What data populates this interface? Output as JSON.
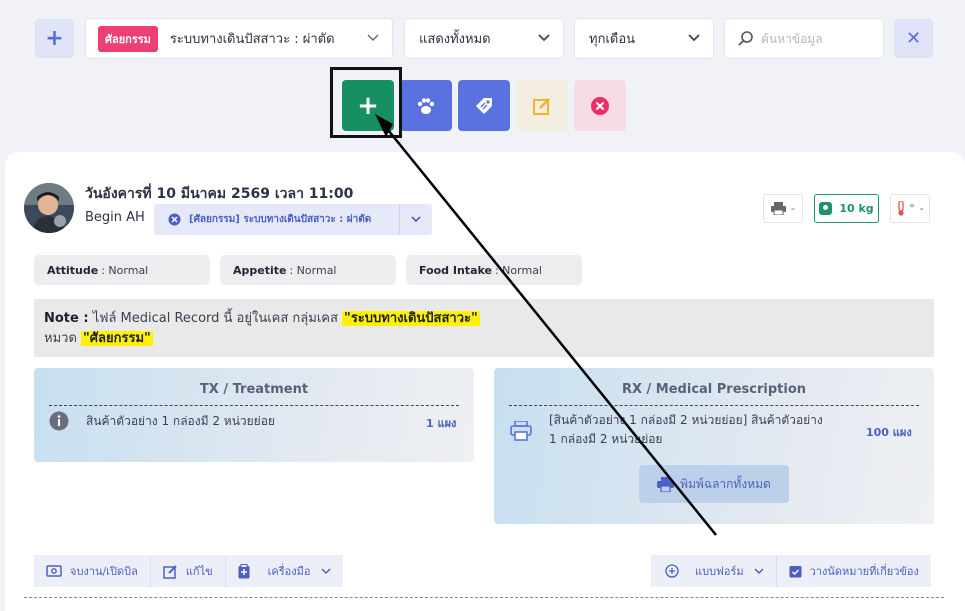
{
  "filters": {
    "case_badge": "ศัลยกรรม",
    "case_label": "ระบบทางเดินปัสสาวะ : ผ่าตัด",
    "show_label": "แสดงทั้งหมด",
    "month_label": "ทุกเดือน",
    "search_placeholder": "ค้นหาข้อมูล"
  },
  "record": {
    "date": "วันอังคารที่ 10 มีนาคม 2569 เวลา 11:00",
    "user": "Begin AH",
    "case_chip": "[ศัลยกรรม] ระบบทางเดินปัสสาวะ : ผ่าตัด",
    "print_value": "-",
    "weight": "10 kg",
    "temp_value": "-"
  },
  "vitals": {
    "attitude_label": "Attitude",
    "attitude_value": ": Normal",
    "appetite_label": "Appetite",
    "appetite_value": ": Normal",
    "food_label": "Food Intake",
    "food_value": ": Normal"
  },
  "note": {
    "label": "Note :",
    "text1": " ไฟล์ Medical Record นี้ อยู่ในเคส กลุ่มเคส ",
    "group": "\"ระบบทางเดินปัสสาวะ\"",
    "text2": "หมวด ",
    "category": "\"ศัลยกรรม\""
  },
  "tx": {
    "title": "TX / Treatment",
    "item": "สินค้าตัวอย่าง 1 กล่องมี 2 หน่วยย่อย",
    "qty": "1 แผง"
  },
  "rx": {
    "title": "RX / Medical Prescription",
    "item_line1": "[สินค้าตัวอย่าง 1 กล่องมี 2 หน่วยย่อย] สินค้าตัวอย่าง",
    "item_line2": "1 กล่องมี 2 หน่วยย่อย",
    "qty": "100 แผง",
    "print_all": "พิมพ์ฉลากทั้งหมด"
  },
  "toolbar": {
    "bill": "จบงาน/เปิดบิล",
    "edit": "แก้ไข",
    "tools": "เครื่องมือ",
    "form": "แบบฟอร์ม",
    "appointment": "วางนัดหมายที่เกี่ยวข้อง"
  },
  "colors": {
    "accent": "#5a72e0",
    "add_green": "#168f61",
    "badge_pink": "#ee3f74",
    "highlight_yellow": "#fff200"
  }
}
